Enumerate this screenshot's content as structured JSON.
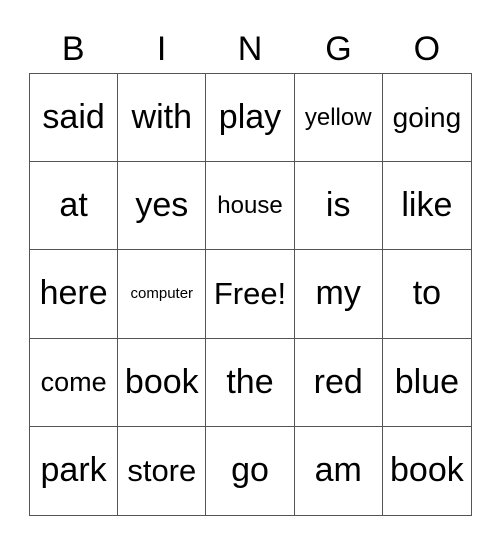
{
  "header": [
    "B",
    "I",
    "N",
    "G",
    "O"
  ],
  "cells": [
    [
      "said",
      "with",
      "play",
      "yellow",
      "going"
    ],
    [
      "at",
      "yes",
      "house",
      "is",
      "like"
    ],
    [
      "here",
      "computer",
      "Free!",
      "my",
      "to"
    ],
    [
      "come",
      "book",
      "the",
      "red",
      "blue"
    ],
    [
      "park",
      "store",
      "go",
      "am",
      "book"
    ]
  ]
}
